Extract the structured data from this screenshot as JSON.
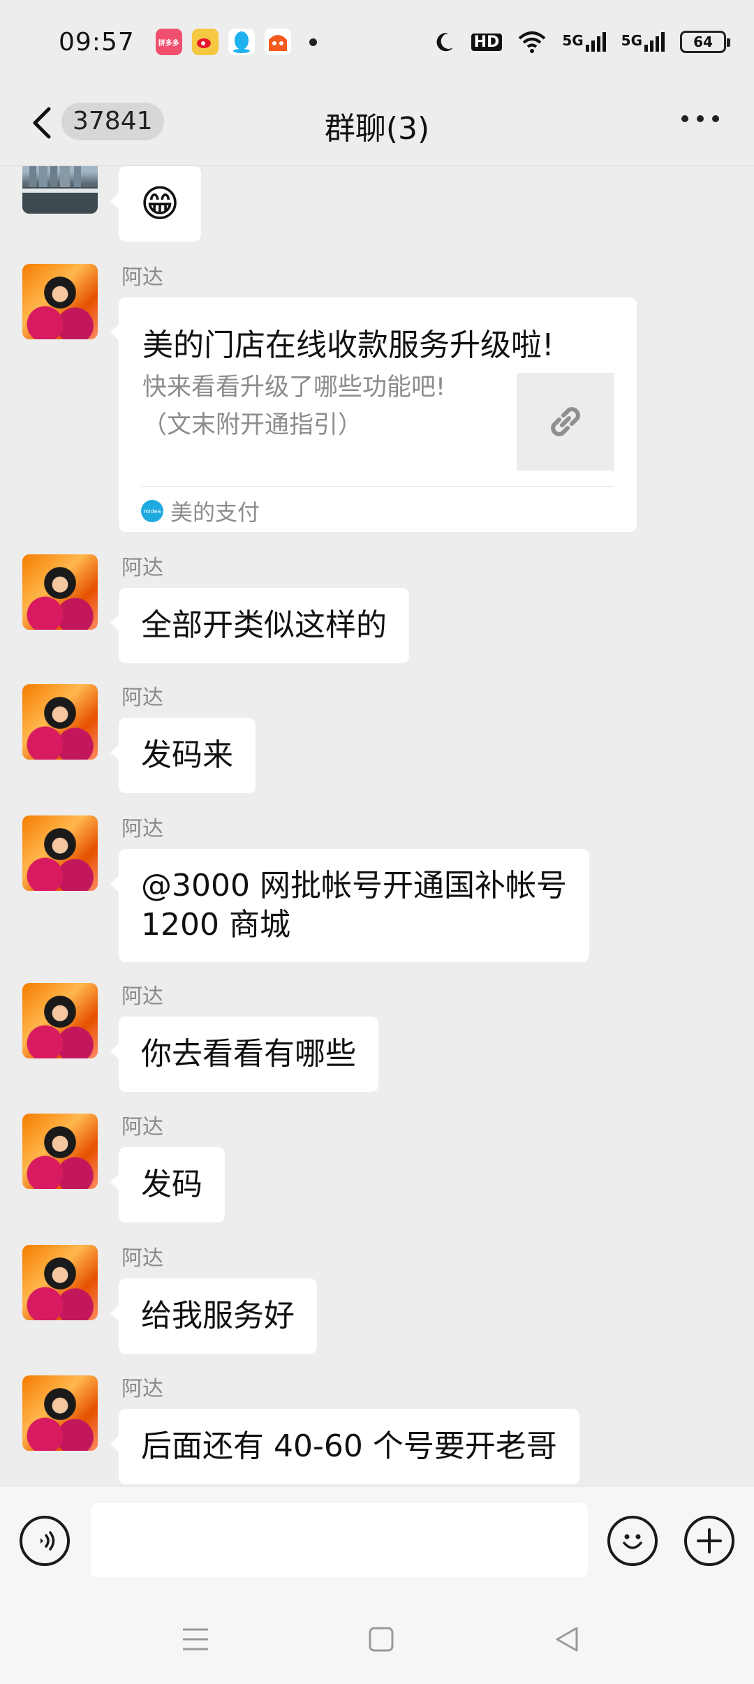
{
  "status_bar": {
    "time": "09:57",
    "apps": [
      {
        "icon": "pinduoduo-app-icon",
        "color": "#f0506e",
        "label": "拼多多"
      },
      {
        "icon": "weibo-app-icon",
        "color": "#f5b22c",
        "label": ""
      },
      {
        "icon": "qq-app-icon",
        "color": "#1fb0f0",
        "label": ""
      },
      {
        "icon": "taobao-app-icon",
        "color": "#f25a1f",
        "label": ""
      }
    ],
    "hd_label": "HD",
    "net1": "5G",
    "net2": "5G",
    "battery": "64"
  },
  "nav": {
    "unread_count": "37841",
    "title": "群聊(3)"
  },
  "messages": [
    {
      "type": "emoji",
      "content": "😁"
    },
    {
      "type": "link",
      "sender": "阿达",
      "title": "美的门店在线收款服务升级啦!",
      "desc_line1": "快来看看升级了哪些功能吧!",
      "desc_line2": "（文末附开通指引）",
      "source": "美的支付",
      "source_icon_text": "midea"
    },
    {
      "type": "text",
      "sender": "阿达",
      "content": "全部开类似这样的"
    },
    {
      "type": "text",
      "sender": "阿达",
      "content": "发码来"
    },
    {
      "type": "text",
      "sender": "阿达",
      "line1": "@3000 网批帐号开通国补帐号",
      "line2": "1200 商城"
    },
    {
      "type": "text",
      "sender": "阿达",
      "content": "你去看看有哪些"
    },
    {
      "type": "text",
      "sender": "阿达",
      "content": "发码"
    },
    {
      "type": "text",
      "sender": "阿达",
      "content": "给我服务好"
    },
    {
      "type": "text",
      "sender": "阿达",
      "content": "后面还有 40-60 个号要开老哥"
    }
  ],
  "input": {
    "placeholder": "",
    "value": ""
  }
}
